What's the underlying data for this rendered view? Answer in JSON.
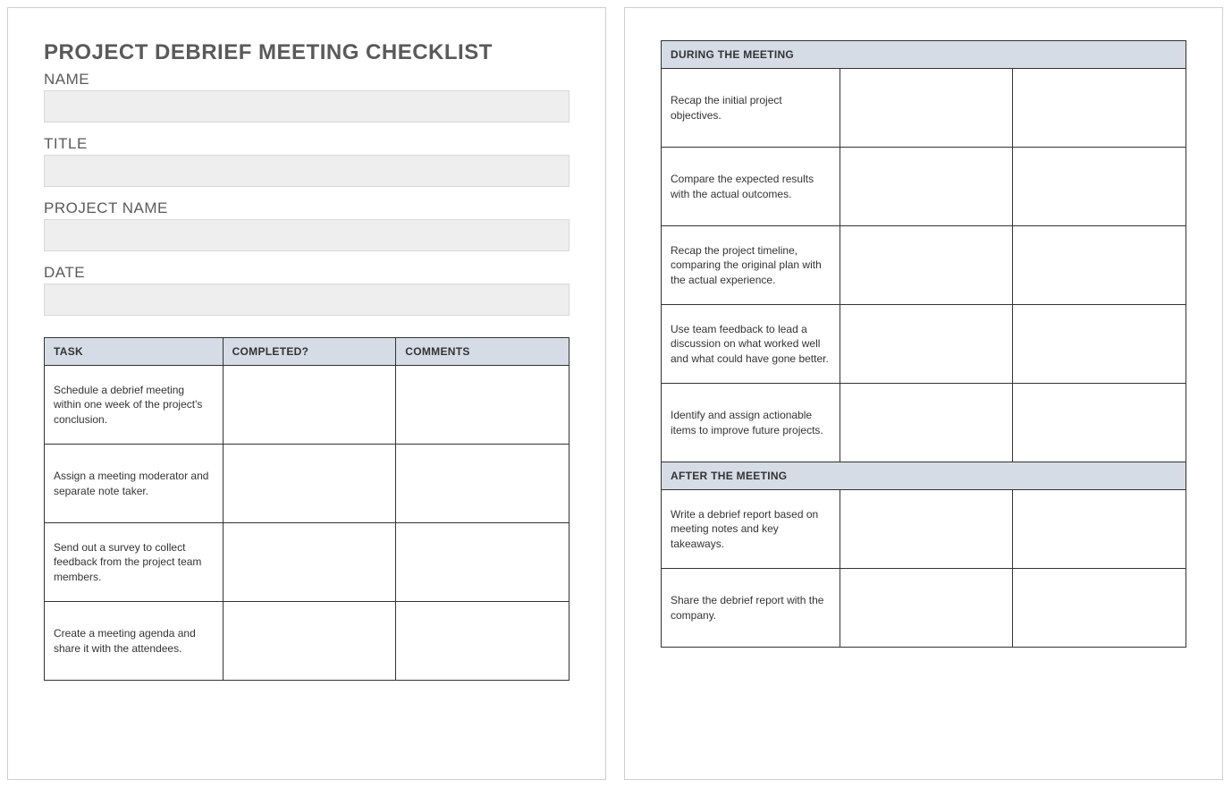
{
  "header": {
    "title": "PROJECT DEBRIEF MEETING CHECKLIST"
  },
  "fields": {
    "name_label": "NAME",
    "title_label": "TITLE",
    "project_name_label": "PROJECT NAME",
    "date_label": "DATE"
  },
  "columns": {
    "task": "TASK",
    "completed": "COMPLETED?",
    "comments": "COMMENTS"
  },
  "sections": {
    "during": "DURING THE MEETING",
    "after": "AFTER THE MEETING"
  },
  "tasks_page1": [
    "Schedule a debrief meeting within one week of the project's conclusion.",
    "Assign a meeting moderator and separate note taker.",
    "Send out a survey to collect feedback from the project team members.",
    "Create a meeting agenda and share it with the attendees."
  ],
  "tasks_during": [
    "Recap the initial project objectives.",
    "Compare the expected results with the actual outcomes.",
    "Recap the project timeline, comparing the original plan with the actual experience.",
    "Use team feedback to lead a discussion on what worked well and what could have gone better.",
    "Identify and assign actionable items to improve future projects."
  ],
  "tasks_after": [
    "Write a debrief report based on meeting notes and key takeaways.",
    "Share the debrief report with the company."
  ]
}
